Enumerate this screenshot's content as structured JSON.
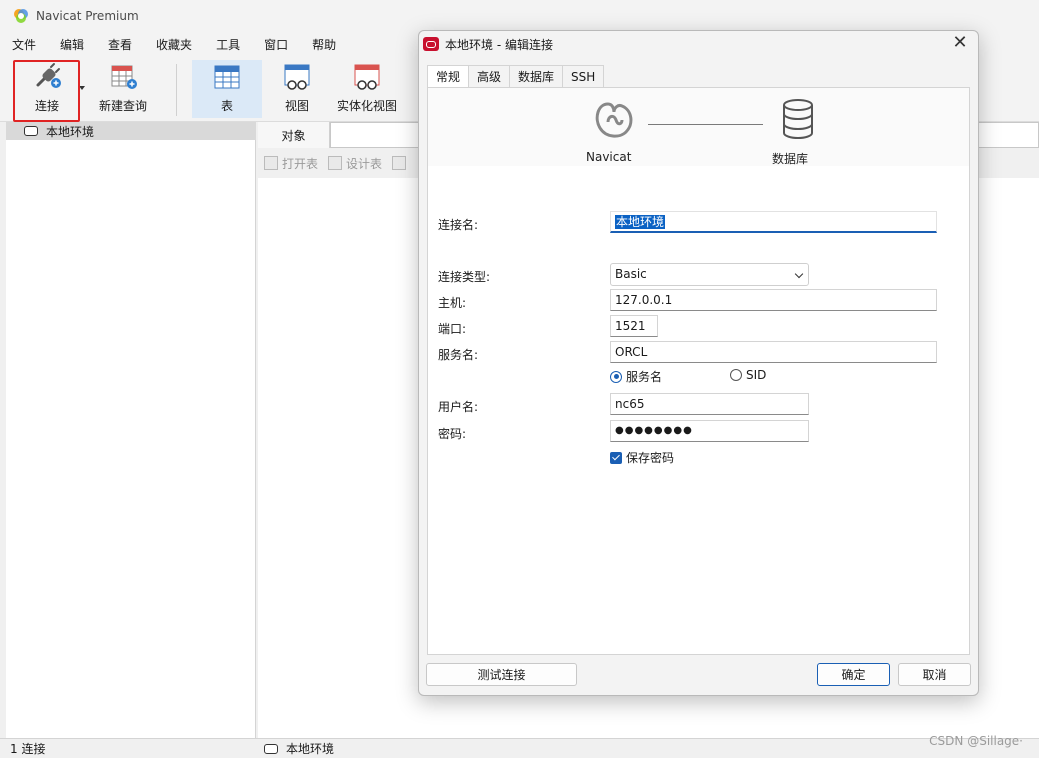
{
  "app": {
    "title": "Navicat Premium"
  },
  "menu": [
    "文件",
    "编辑",
    "查看",
    "收藏夹",
    "工具",
    "窗口",
    "帮助"
  ],
  "toolbar": {
    "connect": "连接",
    "new_query": "新建查询",
    "table": "表",
    "view": "视图",
    "mat_view": "实体化视图"
  },
  "tree": {
    "connection": "本地环境"
  },
  "objects": {
    "tab": "对象",
    "open_table": "打开表",
    "design_table": "设计表"
  },
  "status": {
    "count": "1 连接",
    "current": "本地环境"
  },
  "watermark": "CSDN @Sillage·",
  "dialog": {
    "title": "本地环境 - 编辑连接",
    "tabs": [
      "常规",
      "高级",
      "数据库",
      "SSH"
    ],
    "diagram": {
      "left": "Navicat",
      "right": "数据库"
    },
    "labels": {
      "conn_name": "连接名:",
      "conn_type": "连接类型:",
      "host": "主机:",
      "port": "端口:",
      "service": "服务名:",
      "user": "用户名:",
      "password": "密码:"
    },
    "values": {
      "conn_name": "本地环境",
      "conn_type": "Basic",
      "host": "127.0.0.1",
      "port": "1521",
      "service": "ORCL",
      "user": "nc65",
      "password": "●●●●●●●●"
    },
    "radio": {
      "service_name": "服务名",
      "sid": "SID"
    },
    "save_password": "保存密码",
    "buttons": {
      "test": "测试连接",
      "ok": "确定",
      "cancel": "取消"
    }
  },
  "colors": {
    "accent": "#1a5fb4",
    "highlight": "#e02424",
    "oracle": "#c8102e"
  }
}
